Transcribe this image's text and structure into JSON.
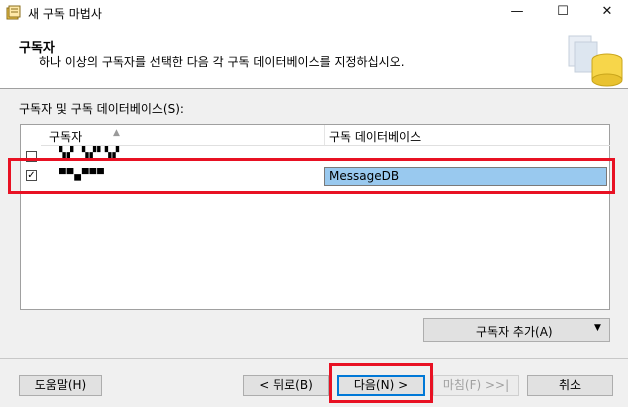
{
  "window": {
    "title": "새 구독 마법사",
    "minimize_glyph": "—",
    "maximize_glyph": "☐",
    "close_glyph": "✕"
  },
  "header": {
    "title": "구독자",
    "description": "하나 이상의 구독자를 선택한 다음 각 구독 데이터베이스를 지정하십시오.",
    "graphic_icon": "database-cylinder-icon"
  },
  "subscribers": {
    "label": "구독자 및 구독 데이터베이스(S):",
    "columns": {
      "subscriber": "구독자",
      "database": "구독 데이터베이스"
    },
    "sort_indicator": "▲",
    "rows": [
      {
        "checked": false,
        "check_glyph": "",
        "name_redacted": "▚▞ ▚▞▘▚▞",
        "database": ""
      },
      {
        "checked": true,
        "check_glyph": "✓",
        "name_redacted": "▀▀▄▀▀▀",
        "database": "MessageDB"
      }
    ],
    "add_button": "구독자 추가(A)",
    "add_arrow": "▼"
  },
  "buttons": {
    "help": "도움말(H)",
    "back": "< 뒤로(B)",
    "next": "다음(N) >",
    "finish": "마침(F) >>|",
    "cancel": "취소"
  },
  "colors": {
    "highlight": "#e81123",
    "selection": "#99c9ef",
    "default_button_border": "#0078d7"
  }
}
